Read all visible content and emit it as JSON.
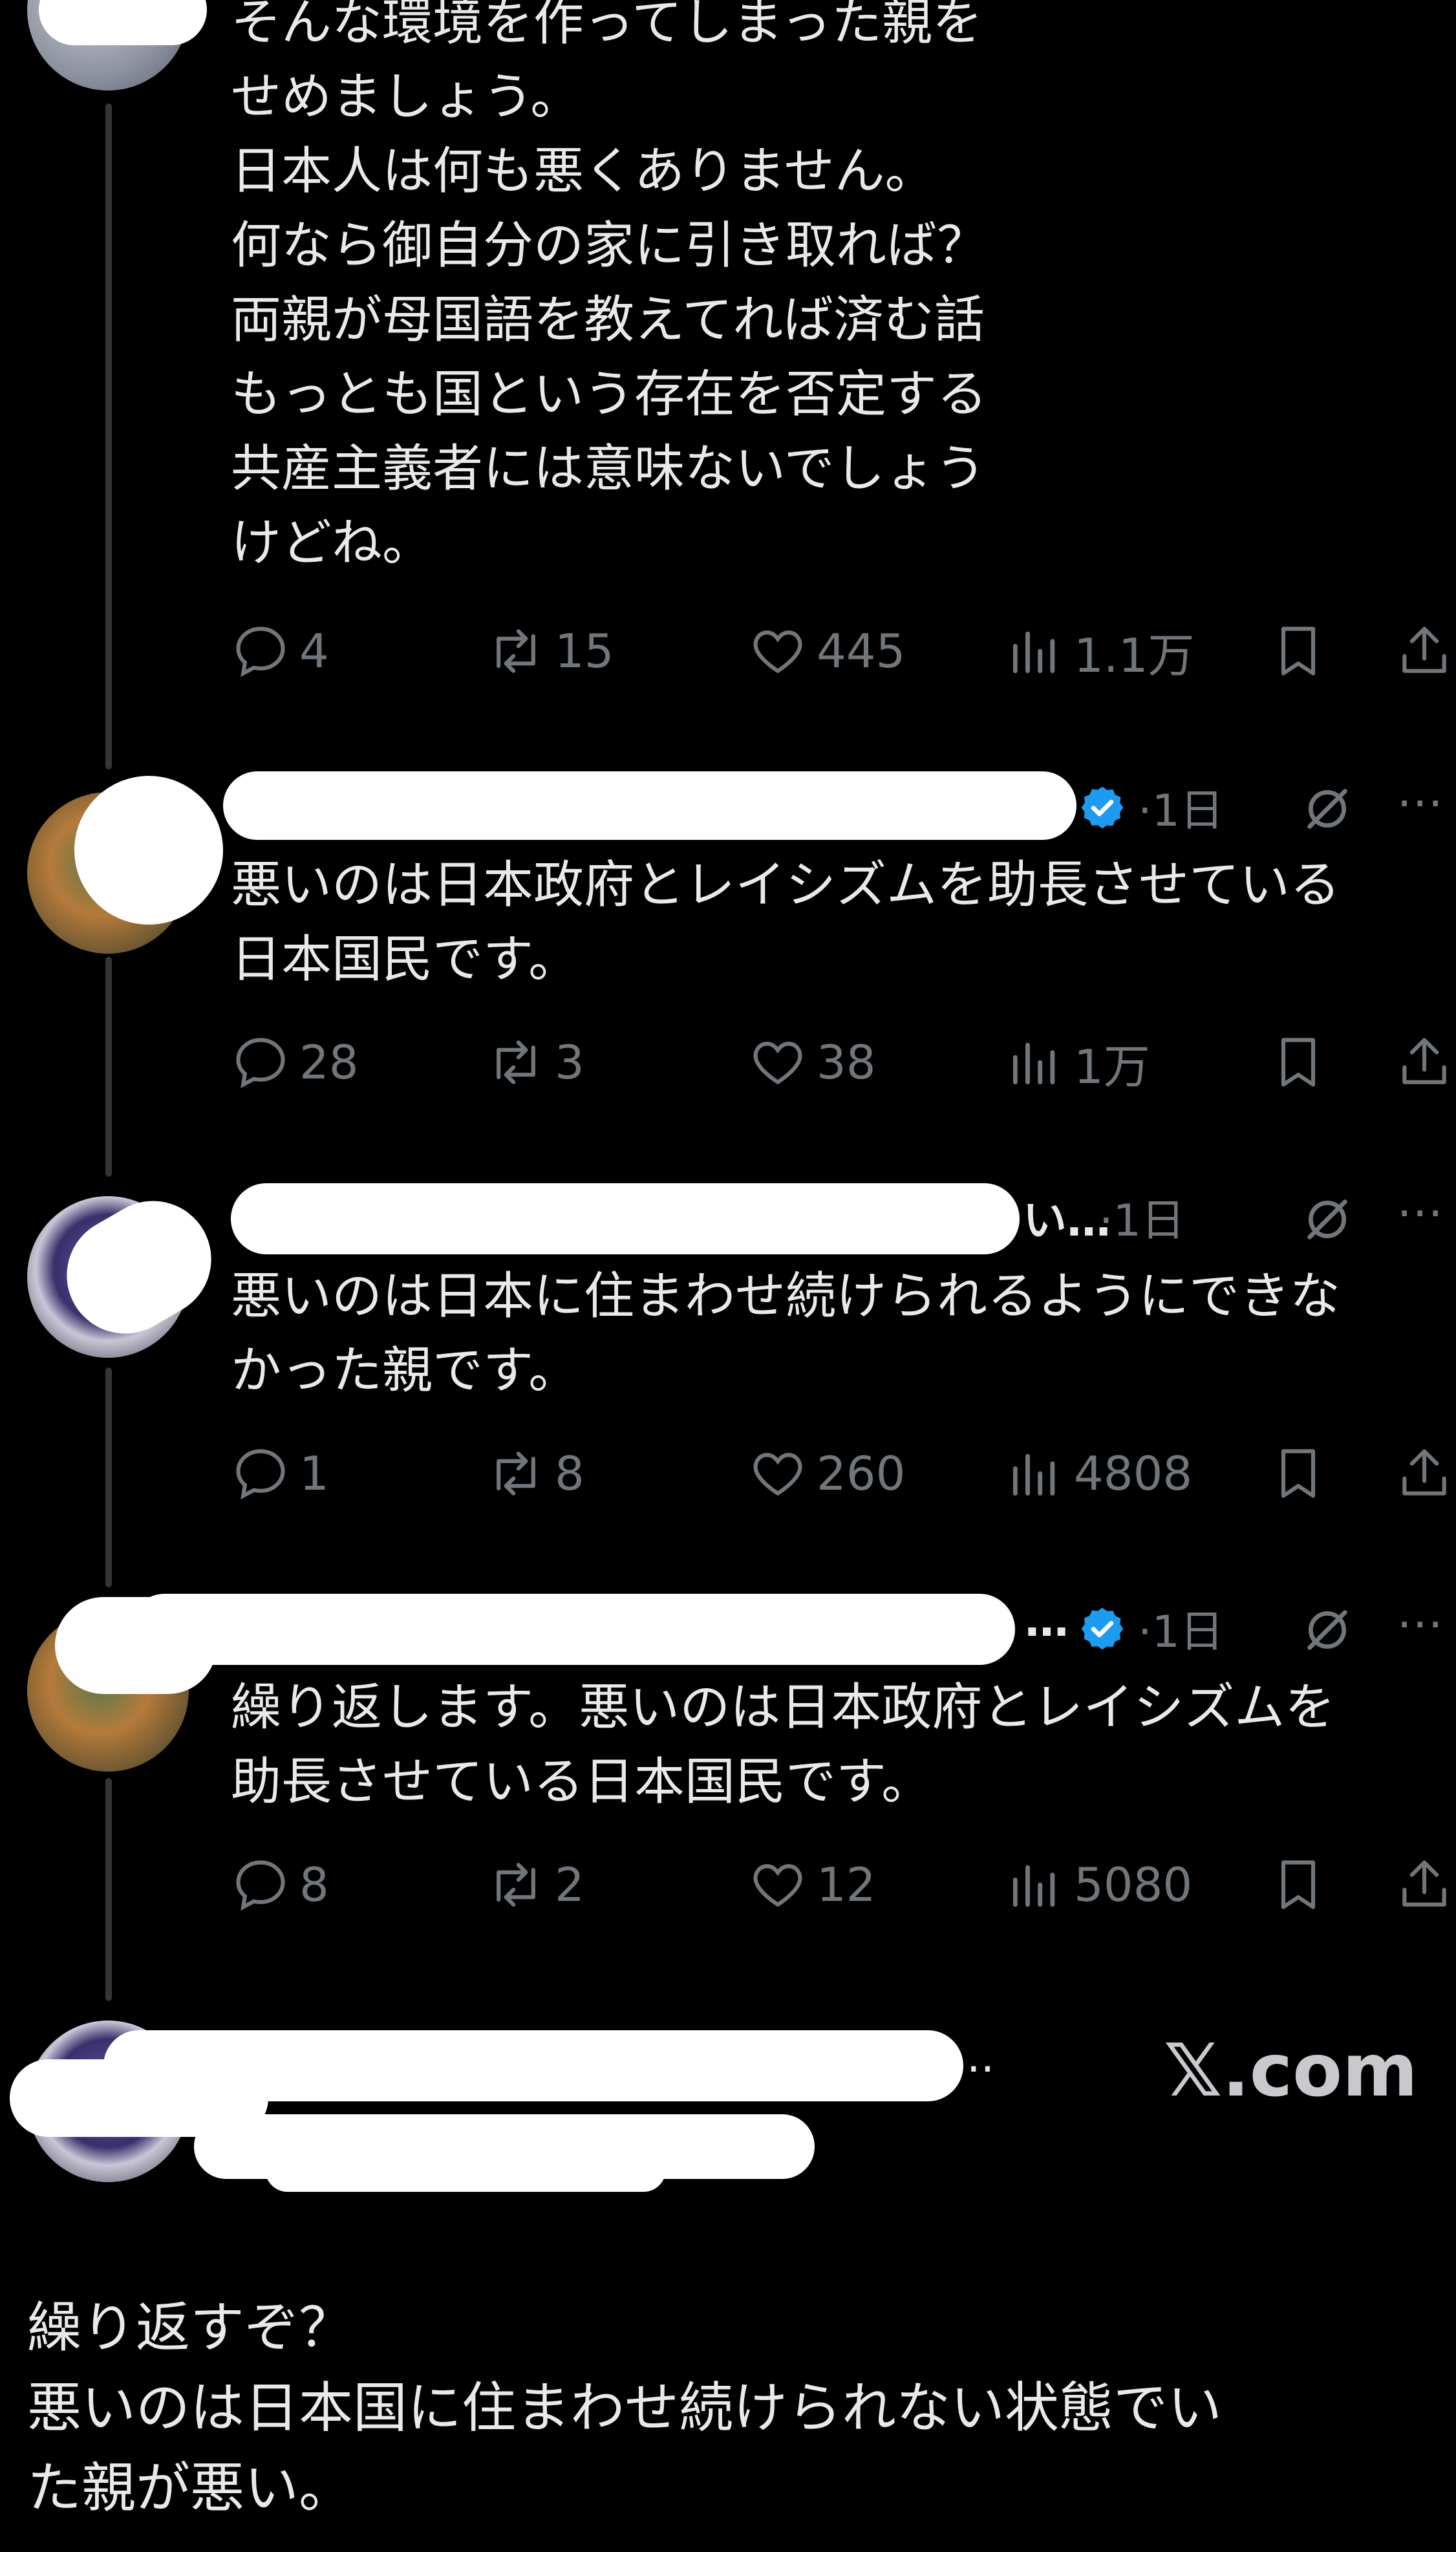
{
  "tweets": [
    {
      "text": "そんな環境を作ってしまった親を\nせめましょう。\n日本人は何も悪くありません。\n何なら御自分の家に引き取れば？\n両親が母国語を教えてれば済む話\nもっとも国という存在を否定する\n共産主義者には意味ないでしょう\nけどね。",
      "replies": "4",
      "retweets": "15",
      "likes": "445",
      "views": "1.1万"
    },
    {
      "handle_tail": "",
      "time": "·1日",
      "verified": true,
      "text": "悪いのは日本政府とレイシズムを助長させている\n日本国民です。",
      "replies": "28",
      "retweets": "3",
      "likes": "38",
      "views": "1万"
    },
    {
      "handle_tail": "い…",
      "time": "·1日",
      "verified": false,
      "text": "悪いのは日本に住まわせ続けられるようにできな\nかった親です。",
      "replies": "1",
      "retweets": "8",
      "likes": "260",
      "views": "4808"
    },
    {
      "handle_tail": "…",
      "time": "·1日",
      "verified": true,
      "text": "繰り返します。悪いのは日本政府とレイシズムを\n助長させている日本国民です。",
      "replies": "8",
      "retweets": "2",
      "likes": "12",
      "views": "5080"
    }
  ],
  "quote_card": {
    "handle_tail": "..",
    "site": "𝕏.com"
  },
  "reply": {
    "text": "繰り返すぞ？\n悪いのは日本国に住まわせ続けられない状態でい\nた親が悪い。"
  },
  "colors": {
    "background": "#000000",
    "text": "#e7e9ea",
    "muted": "#71767b",
    "verified": "#1d9bf0",
    "thread_line": "#333639"
  }
}
